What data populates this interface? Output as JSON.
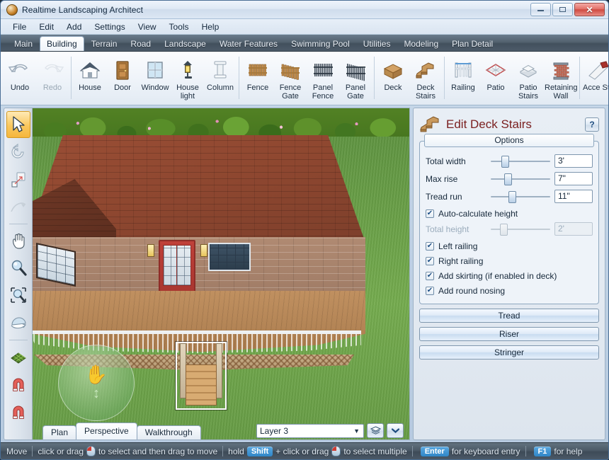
{
  "window": {
    "title": "Realtime Landscaping Architect",
    "icon": "app-globe-icon",
    "minimize": "minimize-icon",
    "maximize": "maximize-icon",
    "close": "✕"
  },
  "menu": [
    "File",
    "Edit",
    "Add",
    "Settings",
    "View",
    "Tools",
    "Help"
  ],
  "tabs": [
    {
      "label": "Main",
      "active": false
    },
    {
      "label": "Building",
      "active": true
    },
    {
      "label": "Terrain",
      "active": false
    },
    {
      "label": "Road",
      "active": false
    },
    {
      "label": "Landscape",
      "active": false
    },
    {
      "label": "Water Features",
      "active": false
    },
    {
      "label": "Swimming Pool",
      "active": false
    },
    {
      "label": "Utilities",
      "active": false
    },
    {
      "label": "Modeling",
      "active": false
    },
    {
      "label": "Plan Detail",
      "active": false
    }
  ],
  "ribbon": [
    {
      "label": "Undo",
      "icon": "undo-arrow-icon",
      "disabled": false
    },
    {
      "label": "Redo",
      "icon": "redo-arrow-icon",
      "disabled": true
    },
    {
      "sep": true
    },
    {
      "label": "House",
      "icon": "house-icon"
    },
    {
      "label": "Door",
      "icon": "door-icon"
    },
    {
      "label": "Window",
      "icon": "window-icon"
    },
    {
      "label": "House light",
      "icon": "house-light-icon"
    },
    {
      "label": "Column",
      "icon": "column-icon"
    },
    {
      "sep": true
    },
    {
      "label": "Fence",
      "icon": "fence-icon"
    },
    {
      "label": "Fence Gate",
      "icon": "fence-gate-icon"
    },
    {
      "label": "Panel Fence",
      "icon": "panel-fence-icon"
    },
    {
      "label": "Panel Gate",
      "icon": "panel-gate-icon"
    },
    {
      "sep": true
    },
    {
      "label": "Deck",
      "icon": "deck-icon"
    },
    {
      "label": "Deck Stairs",
      "icon": "deck-stairs-icon"
    },
    {
      "sep": true
    },
    {
      "label": "Railing",
      "icon": "railing-icon"
    },
    {
      "label": "Patio",
      "icon": "patio-icon"
    },
    {
      "label": "Patio Stairs",
      "icon": "patio-stairs-icon"
    },
    {
      "label": "Retaining Wall",
      "icon": "retaining-wall-icon"
    },
    {
      "sep": true
    },
    {
      "label": "Acce Stri",
      "icon": "accent-strip-icon"
    }
  ],
  "tools": [
    {
      "name": "select-arrow-tool",
      "icon": "arrow-cursor-icon",
      "active": true
    },
    {
      "name": "rotate-tool",
      "icon": "rotate-icon",
      "active": false
    },
    {
      "name": "scale-tool",
      "icon": "scale-icon",
      "active": false
    },
    {
      "name": "bend-tool",
      "icon": "bend-curve-icon",
      "active": false
    },
    {
      "sep": true
    },
    {
      "name": "pan-tool",
      "icon": "hand-icon",
      "active": false
    },
    {
      "name": "zoom-tool",
      "icon": "magnifier-icon",
      "active": false
    },
    {
      "name": "zoom-region-tool",
      "icon": "zoom-region-icon",
      "active": false
    },
    {
      "name": "orbit-tool",
      "icon": "orbit-icon",
      "active": false
    },
    {
      "sep": true
    },
    {
      "name": "grid-tool",
      "icon": "grid-icon",
      "active": false
    },
    {
      "name": "snap-tool",
      "icon": "magnet-icon",
      "active": false
    },
    {
      "name": "snap-angle-tool",
      "icon": "magnet-icon",
      "active": false
    }
  ],
  "viewport": {
    "view_tabs": [
      {
        "label": "Plan",
        "active": false
      },
      {
        "label": "Perspective",
        "active": true
      },
      {
        "label": "Walkthrough",
        "active": false
      }
    ],
    "layer": {
      "value": "Layer 3",
      "caret": "▼",
      "layers_button": "layers-stack-icon",
      "dropdown_button": "chevron-down-icon"
    },
    "gizmo": {
      "hand": "✋",
      "arrows": "↕"
    }
  },
  "panel": {
    "title": "Edit Deck Stairs",
    "icon": "deck-stairs-icon",
    "help": "?",
    "group_title": "Options",
    "sliders": [
      {
        "label": "Total width",
        "value": "3'",
        "pos": 18,
        "disabled": false
      },
      {
        "label": "Max rise",
        "value": "7\"",
        "pos": 23,
        "disabled": false
      },
      {
        "label": "Tread run",
        "value": "11\"",
        "pos": 30,
        "disabled": false
      }
    ],
    "auto_height": {
      "label": "Auto-calculate height",
      "checked": true
    },
    "total_height": {
      "label": "Total height",
      "value": "2'",
      "pos": 16,
      "disabled": true
    },
    "checkboxes": [
      {
        "label": "Left railing",
        "checked": true
      },
      {
        "label": "Right railing",
        "checked": true
      },
      {
        "label": "Add skirting (if enabled in deck)",
        "checked": true
      },
      {
        "label": "Add round nosing",
        "checked": true
      }
    ],
    "buttons": [
      "Tread",
      "Riser",
      "Stringer"
    ],
    "check_mark": "✔"
  },
  "statusbar": {
    "mode": "Move",
    "hint1": "click or drag",
    "hint2": "to select and then drag to move",
    "hold": "hold",
    "shift_key": "Shift",
    "plus": "+ click or drag",
    "hint3": "to select multiple",
    "enter_key": "Enter",
    "hint4": "for keyboard entry",
    "f1_key": "F1",
    "hint5": "for help"
  },
  "colors": {
    "accent_blue": "#2f86c8",
    "panel_title": "#7a1f1f",
    "tab_active_bg": "#ffffff",
    "tool_active": "#f9c75e"
  }
}
